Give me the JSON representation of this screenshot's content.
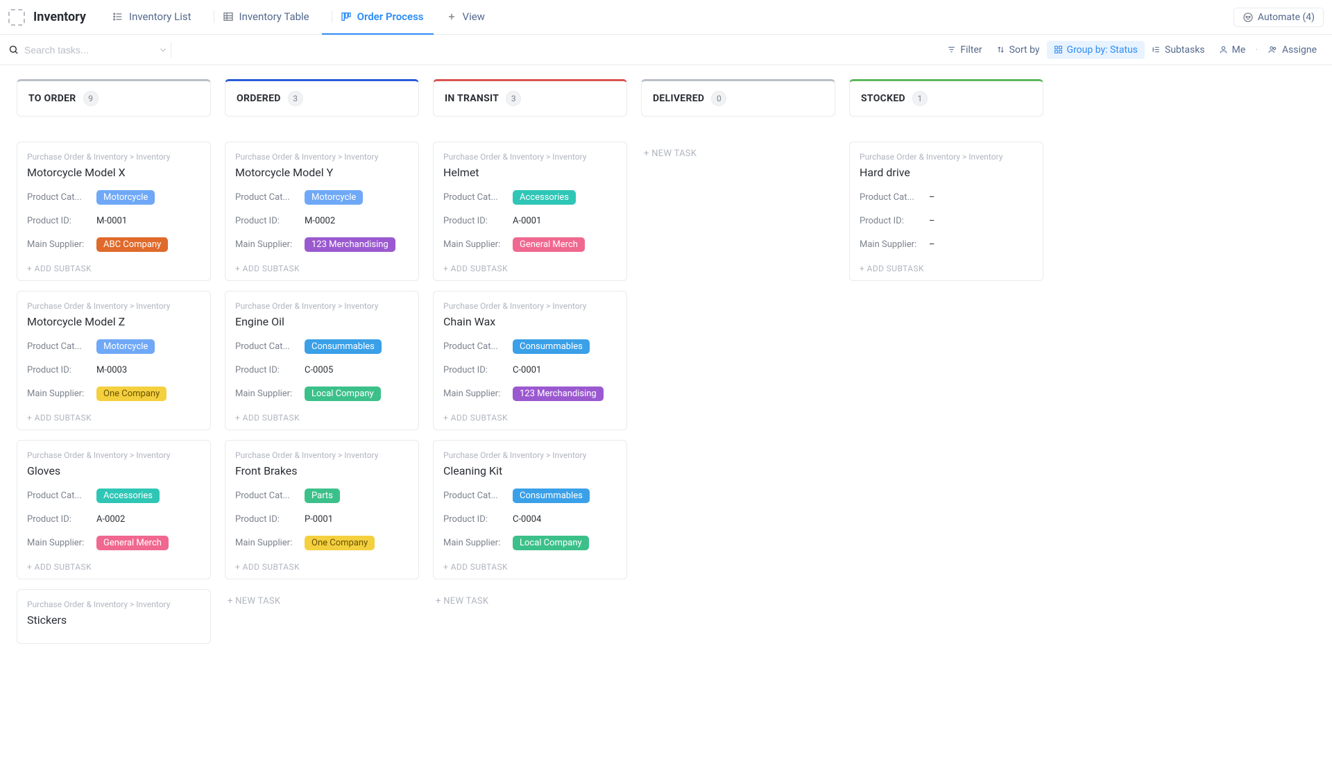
{
  "header": {
    "title": "Inventory",
    "tabs": [
      {
        "label": "Inventory List",
        "icon": "list-icon",
        "active": false
      },
      {
        "label": "Inventory Table",
        "icon": "table-icon",
        "active": false
      },
      {
        "label": "Order Process",
        "icon": "board-icon",
        "active": true
      },
      {
        "label": "View",
        "icon": "plus-icon",
        "active": false
      }
    ],
    "automate": {
      "label": "Automate (4)"
    }
  },
  "toolbar": {
    "search_placeholder": "Search tasks...",
    "filter": "Filter",
    "sort": "Sort by",
    "group": "Group by: Status",
    "subtasks": "Subtasks",
    "me": "Me",
    "assignees": "Assigne"
  },
  "labels": {
    "add_subtask": "+ ADD SUBTASK",
    "new_task": "+ NEW TASK",
    "breadcrumb": "Purchase Order & Inventory  >  Inventory",
    "field_category": "Product Cat...",
    "field_product_id": "Product ID:",
    "field_supplier": "Main Supplier:",
    "empty": "–"
  },
  "pill_colors": {
    "Motorcycle": "#6fa8f7",
    "Accessories": "#2fc6b6",
    "Consummables": "#3aa0e8",
    "Parts": "#3cc08a",
    "ABC Company": "#e06a2b",
    "123 Merchandising": "#9b59d0",
    "General Merch": "#f0688f",
    "One Company": "#f4d03f",
    "Local Company": "#3cc08a"
  },
  "columns": [
    {
      "name": "TO ORDER",
      "count": 9,
      "accent": "#b9bec7",
      "cards": [
        {
          "title": "Motorcycle Model X",
          "category": "Motorcycle",
          "product_id": "M-0001",
          "supplier": "ABC Company"
        },
        {
          "title": "Motorcycle Model Z",
          "category": "Motorcycle",
          "product_id": "M-0003",
          "supplier": "One Company"
        },
        {
          "title": "Gloves",
          "category": "Accessories",
          "product_id": "A-0002",
          "supplier": "General Merch"
        },
        {
          "title": "Stickers"
        }
      ],
      "show_new_task": false
    },
    {
      "name": "ORDERED",
      "count": 3,
      "accent": "#2a5bd7",
      "cards": [
        {
          "title": "Motorcycle Model Y",
          "category": "Motorcycle",
          "product_id": "M-0002",
          "supplier": "123 Merchandising"
        },
        {
          "title": "Engine Oil",
          "category": "Consummables",
          "product_id": "C-0005",
          "supplier": "Local Company"
        },
        {
          "title": "Front Brakes",
          "category": "Parts",
          "product_id": "P-0001",
          "supplier": "One Company"
        }
      ],
      "show_new_task": true
    },
    {
      "name": "IN TRANSIT",
      "count": 3,
      "accent": "#d9534f",
      "cards": [
        {
          "title": "Helmet",
          "category": "Accessories",
          "product_id": "A-0001",
          "supplier": "General Merch"
        },
        {
          "title": "Chain Wax",
          "category": "Consummables",
          "product_id": "C-0001",
          "supplier": "123 Merchandising"
        },
        {
          "title": "Cleaning Kit",
          "category": "Consummables",
          "product_id": "C-0004",
          "supplier": "Local Company"
        }
      ],
      "show_new_task": true
    },
    {
      "name": "DELIVERED",
      "count": 0,
      "accent": "#b9bec7",
      "cards": [],
      "show_new_task": true
    },
    {
      "name": "STOCKED",
      "count": 1,
      "accent": "#5cb85c",
      "cards": [
        {
          "title": "Hard drive",
          "category": null,
          "product_id": null,
          "supplier": null
        }
      ],
      "show_new_task": false
    }
  ]
}
